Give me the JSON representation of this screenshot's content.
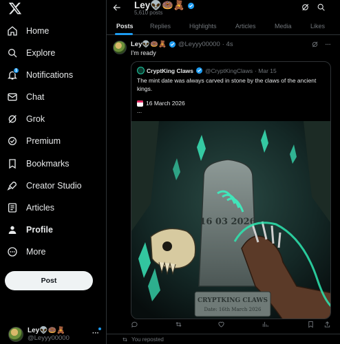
{
  "sidebar": {
    "logo": "x-logo",
    "items": [
      {
        "label": "Home",
        "icon": "home-icon"
      },
      {
        "label": "Explore",
        "icon": "search-icon"
      },
      {
        "label": "Notifications",
        "icon": "bell-icon",
        "badge": "1"
      },
      {
        "label": "Chat",
        "icon": "mail-icon"
      },
      {
        "label": "Grok",
        "icon": "grok-icon"
      },
      {
        "label": "Premium",
        "icon": "premium-icon"
      },
      {
        "label": "Bookmarks",
        "icon": "bookmark-icon"
      },
      {
        "label": "Creator Studio",
        "icon": "rocket-icon"
      },
      {
        "label": "Articles",
        "icon": "article-icon"
      },
      {
        "label": "Profile",
        "icon": "person-icon"
      },
      {
        "label": "More",
        "icon": "more-circle-icon"
      }
    ],
    "post_label": "Post",
    "account": {
      "name": "Ley👽🍩🧸",
      "handle": "@Leyyy00000"
    }
  },
  "header": {
    "title": "Ley👽🍩🧸",
    "subtitle": "5,610 posts"
  },
  "tabs": [
    "Posts",
    "Replies",
    "Highlights",
    "Articles",
    "Media",
    "Likes"
  ],
  "tweet": {
    "name": "Ley👽🍩🧸",
    "handle": "@Leyyy00000",
    "time": "· 4s",
    "text": "I'm ready",
    "quote": {
      "name": "CryptKing Claws",
      "handle": "@CryptKingClaws",
      "time": "· Mar 15",
      "text": "The mint date was always carved in stone by the claws of the ancient kings.",
      "date_line": "16 March 2026",
      "ellipsis": "...",
      "image": {
        "stone_text": "16 03 2026",
        "plaque_title": "CRYPTKING CLAWS",
        "plaque_sub": "Date: 16th March 2026"
      }
    }
  },
  "next": {
    "reposted_label": "You reposted"
  },
  "colors": {
    "accent": "#1d9bf0",
    "muted": "#71767b",
    "glow": "#2ee6b0"
  }
}
